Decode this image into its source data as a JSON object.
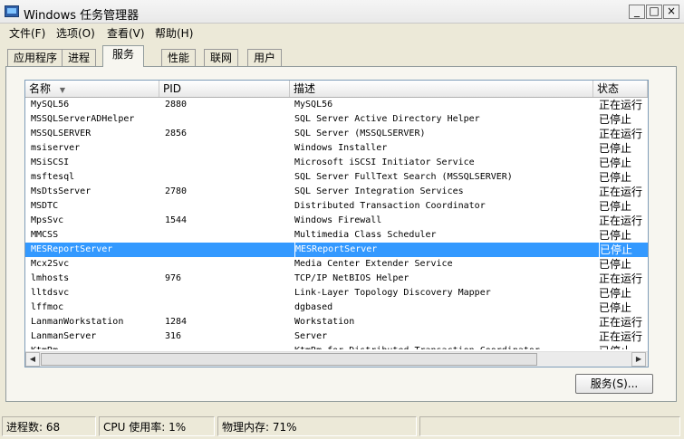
{
  "window": {
    "title": "Windows 任务管理器",
    "minimize": "_",
    "maximize": "□",
    "close": "×"
  },
  "menu": [
    "文件(F)",
    "选项(O)",
    "查看(V)",
    "帮助(H)"
  ],
  "tabs": [
    "应用程序",
    "进程",
    "服务",
    "性能",
    "联网",
    "用户"
  ],
  "active_tab": "服务",
  "list": {
    "columns": [
      "名称",
      "PID",
      "描述",
      "状态"
    ],
    "sort_icon": "▼",
    "rows": [
      {
        "name": "MySQL56",
        "pid": "2880",
        "desc": "MySQL56",
        "status": "正在运行"
      },
      {
        "name": "MSSQLServerADHelper",
        "pid": "",
        "desc": "SQL Server Active Directory Helper",
        "status": "已停止"
      },
      {
        "name": "MSSQLSERVER",
        "pid": "2856",
        "desc": "SQL Server (MSSQLSERVER)",
        "status": "正在运行"
      },
      {
        "name": "msiserver",
        "pid": "",
        "desc": "Windows Installer",
        "status": "已停止"
      },
      {
        "name": "MSiSCSI",
        "pid": "",
        "desc": "Microsoft iSCSI Initiator Service",
        "status": "已停止"
      },
      {
        "name": "msftesql",
        "pid": "",
        "desc": "SQL Server FullText Search (MSSQLSERVER)",
        "status": "已停止"
      },
      {
        "name": "MsDtsServer",
        "pid": "2780",
        "desc": "SQL Server Integration Services",
        "status": "正在运行"
      },
      {
        "name": "MSDTC",
        "pid": "",
        "desc": "Distributed Transaction Coordinator",
        "status": "已停止"
      },
      {
        "name": "MpsSvc",
        "pid": "1544",
        "desc": "Windows Firewall",
        "status": "正在运行"
      },
      {
        "name": "MMCSS",
        "pid": "",
        "desc": "Multimedia Class Scheduler",
        "status": "已停止"
      },
      {
        "name": "MESReportServer",
        "pid": "",
        "desc": "MESReportServer",
        "status": "已停止",
        "selected": true
      },
      {
        "name": "Mcx2Svc",
        "pid": "",
        "desc": "Media Center Extender Service",
        "status": "已停止"
      },
      {
        "name": "lmhosts",
        "pid": "976",
        "desc": "TCP/IP NetBIOS Helper",
        "status": "正在运行"
      },
      {
        "name": "lltdsvc",
        "pid": "",
        "desc": "Link-Layer Topology Discovery Mapper",
        "status": "已停止"
      },
      {
        "name": "lffmoc",
        "pid": "",
        "desc": "dgbased",
        "status": "已停止"
      },
      {
        "name": "LanmanWorkstation",
        "pid": "1284",
        "desc": "Workstation",
        "status": "正在运行"
      },
      {
        "name": "LanmanServer",
        "pid": "316",
        "desc": "Server",
        "status": "正在运行"
      },
      {
        "name": "KtmRm",
        "pid": "",
        "desc": "KtmRm for Distributed Transaction Coordinator",
        "status": "已停止"
      }
    ]
  },
  "scroll": {
    "up": "▲",
    "down": "▼",
    "left": "◀",
    "right": "▶"
  },
  "services_button": "服务(S)...",
  "statusbar": {
    "processes": "进程数: 68",
    "cpu": "CPU 使用率: 1%",
    "memory": "物理内存: 71%"
  },
  "colors": {
    "selection": "#3399ff",
    "background": "#ece9d8"
  }
}
